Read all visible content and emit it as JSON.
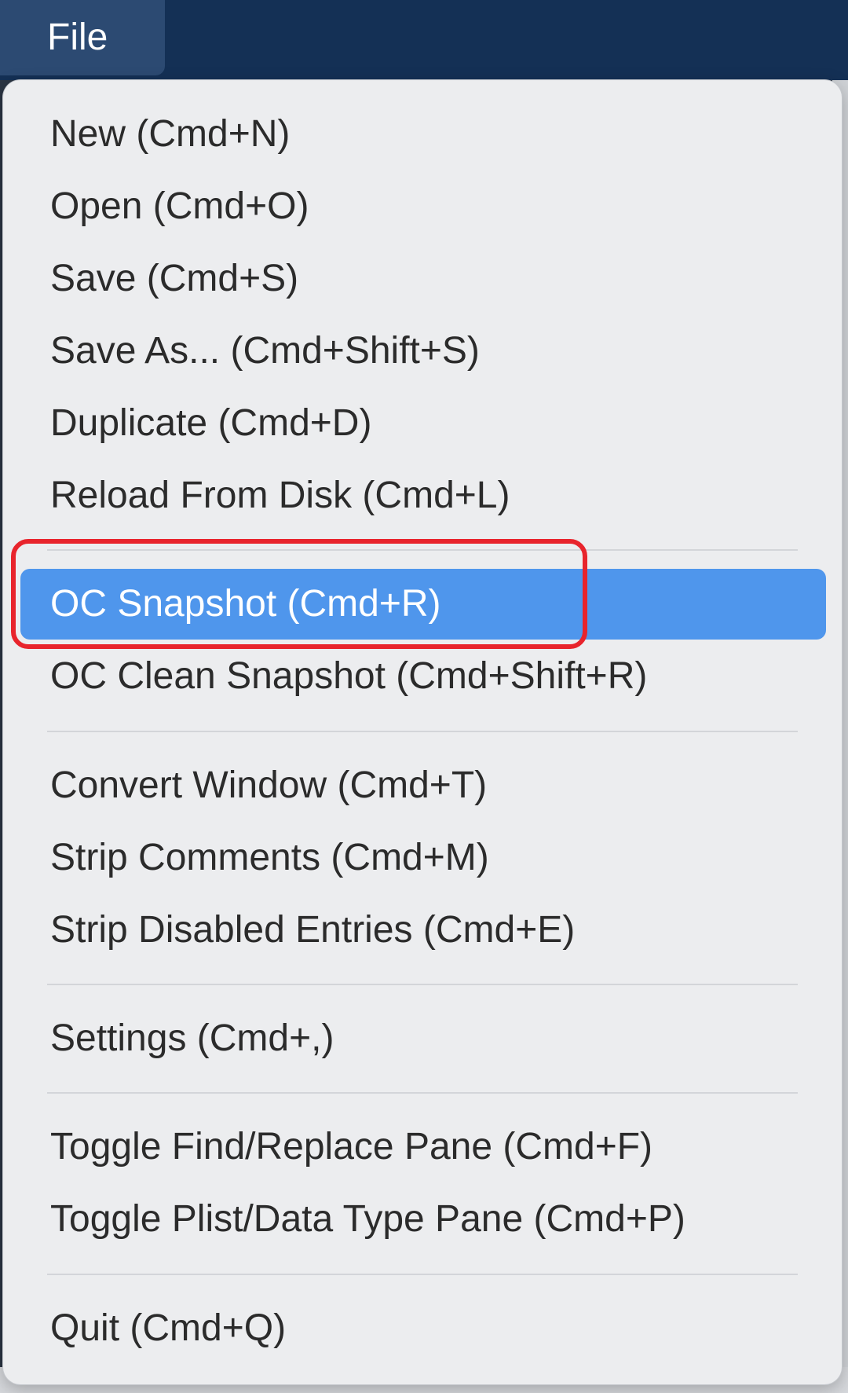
{
  "menubar": {
    "file_label": "File"
  },
  "menu": {
    "items": [
      {
        "label": "New (Cmd+N)"
      },
      {
        "label": "Open (Cmd+O)"
      },
      {
        "label": "Save (Cmd+S)"
      },
      {
        "label": "Save As... (Cmd+Shift+S)"
      },
      {
        "label": "Duplicate (Cmd+D)"
      },
      {
        "label": "Reload From Disk (Cmd+L)"
      },
      {
        "label": "OC Snapshot (Cmd+R)",
        "highlighted": true
      },
      {
        "label": "OC Clean Snapshot (Cmd+Shift+R)"
      },
      {
        "label": "Convert Window (Cmd+T)"
      },
      {
        "label": "Strip Comments (Cmd+M)"
      },
      {
        "label": "Strip Disabled Entries (Cmd+E)"
      },
      {
        "label": "Settings (Cmd+,)"
      },
      {
        "label": "Toggle Find/Replace Pane (Cmd+F)"
      },
      {
        "label": "Toggle Plist/Data Type Pane (Cmd+P)"
      },
      {
        "label": "Quit (Cmd+Q)"
      }
    ]
  },
  "colors": {
    "menubar_bg": "#143055",
    "menu_bg": "#ecedef",
    "highlight": "#4f96ec",
    "callout": "#e8242c"
  }
}
